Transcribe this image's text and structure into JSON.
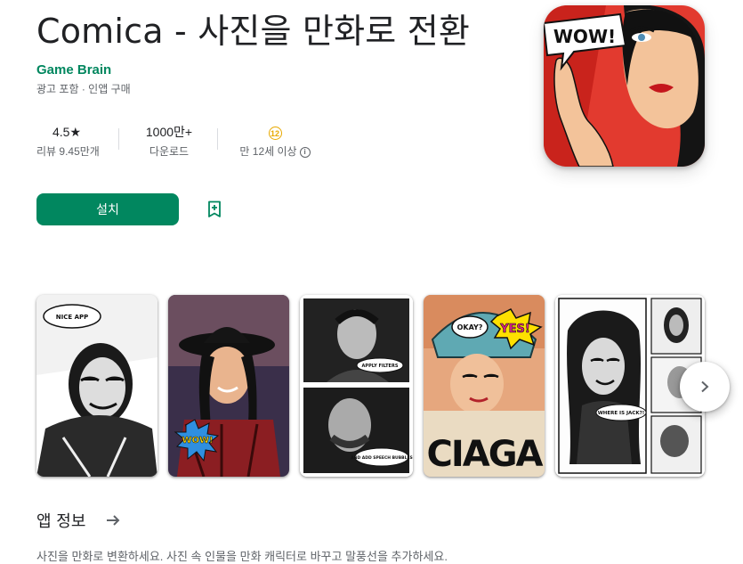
{
  "app": {
    "title": "Comica - 사진을 만화로 전환",
    "developer": "Game Brain",
    "subtitle": "광고 포함 · 인앱 구매"
  },
  "stats": {
    "rating_value": "4.5★",
    "rating_label": "리뷰 9.45만개",
    "downloads_value": "1000만+",
    "downloads_label": "다운로드",
    "age_badge": "12",
    "age_label": "만 12세 이상"
  },
  "actions": {
    "install_label": "설치"
  },
  "icon_text": "WOW!",
  "screenshots": [
    {
      "bubble": "NICE APP"
    },
    {
      "badge": "WOW!"
    },
    {
      "top_caption": "APPLY FILTERS",
      "bottom_caption": "AND ADD SPEECH BUBBLES"
    },
    {
      "bubble": "OKAY?",
      "badge": "YES!",
      "text": "CIAGA"
    },
    {
      "bubble": "WHERE IS JACK?!"
    }
  ],
  "about": {
    "heading": "앱 정보",
    "description": "사진을 만화로 변환하세요. 사진 속 인물을 만화 캐릭터로 바꾸고 말풍선을 추가하세요."
  },
  "colors": {
    "accent": "#01875f",
    "age_badge": "#e8a900"
  }
}
